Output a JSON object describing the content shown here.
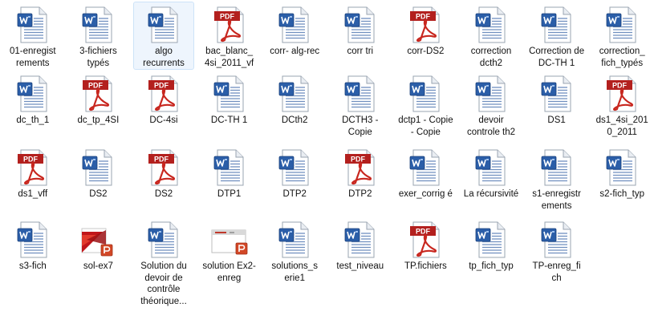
{
  "colors": {
    "selection_bg": "#eef5fd",
    "selection_border": "#cde3f8",
    "pdf_red": "#b3201e",
    "word_blue": "#2b5ea8"
  },
  "files": [
    {
      "name": "01-enregistrements",
      "label": "01-enregist rements",
      "icon": "word-document-icon"
    },
    {
      "name": "3-fichiers typés",
      "label": "3-fichiers typés",
      "icon": "word-document-icon"
    },
    {
      "name": "algo recurrents",
      "label": "algo recurrents",
      "icon": "word-document-icon",
      "selected": true
    },
    {
      "name": "bac_blanc_4si_2011_vf",
      "label": "bac_blanc_ 4si_2011_vf",
      "icon": "pdf-document-icon"
    },
    {
      "name": "corr-alg-rec",
      "label": "corr- alg-rec",
      "icon": "word-document-icon"
    },
    {
      "name": "corr tri",
      "label": "corr tri",
      "icon": "word-document-icon"
    },
    {
      "name": "corr-DS2",
      "label": "corr-DS2",
      "icon": "pdf-document-icon"
    },
    {
      "name": "correction dcth2",
      "label": "correction dcth2",
      "icon": "word-document-icon"
    },
    {
      "name": "Correction de DC-TH 1",
      "label": "Correction de DC-TH 1",
      "icon": "word-document-icon"
    },
    {
      "name": "correction_fich_typés",
      "label": "correction_ fich_typés",
      "icon": "word-document-icon"
    },
    {
      "name": "dc_th_1",
      "label": "dc_th_1",
      "icon": "word-document-icon"
    },
    {
      "name": "dc_tp_4SI",
      "label": "dc_tp_4SI",
      "icon": "pdf-document-icon"
    },
    {
      "name": "DC-4si",
      "label": "DC-4si",
      "icon": "pdf-document-icon"
    },
    {
      "name": "DC-TH 1",
      "label": "DC-TH 1",
      "icon": "word-document-icon"
    },
    {
      "name": "DCth2",
      "label": "DCth2",
      "icon": "word-document-icon"
    },
    {
      "name": "DCTH3 - Copie",
      "label": "DCTH3 - Copie",
      "icon": "word-document-icon"
    },
    {
      "name": "dctp1 - Copie - Copie",
      "label": "dctp1 - Copie - Copie",
      "icon": "word-document-icon"
    },
    {
      "name": "devoir controle th2",
      "label": "devoir controle th2",
      "icon": "word-document-icon"
    },
    {
      "name": "DS1",
      "label": "DS1",
      "icon": "word-document-icon"
    },
    {
      "name": "ds1_4si_2010_2011",
      "label": "ds1_4si_201 0_2011",
      "icon": "pdf-document-icon"
    },
    {
      "name": "ds1_vff",
      "label": "ds1_vff",
      "icon": "pdf-document-icon"
    },
    {
      "name": "DS2",
      "label": "DS2",
      "icon": "word-document-icon"
    },
    {
      "name": "DS2",
      "label": "DS2",
      "icon": "pdf-document-icon"
    },
    {
      "name": "DTP1",
      "label": "DTP1",
      "icon": "word-document-icon"
    },
    {
      "name": "DTP2",
      "label": "DTP2",
      "icon": "word-document-icon"
    },
    {
      "name": "DTP2",
      "label": "DTP2",
      "icon": "pdf-document-icon"
    },
    {
      "name": "exer_corrigé",
      "label": "exer_corrig é",
      "icon": "word-document-icon"
    },
    {
      "name": "La récursivité",
      "label": "La récursivité",
      "icon": "word-document-icon"
    },
    {
      "name": "s1-enregistrements",
      "label": "s1-enregistr ements",
      "icon": "word-document-icon"
    },
    {
      "name": "s2-fich_typ",
      "label": "s2-fich_typ",
      "icon": "word-document-icon"
    },
    {
      "name": "s3-fich",
      "label": "s3-fich",
      "icon": "word-document-icon"
    },
    {
      "name": "sol-ex7",
      "label": "sol-ex7",
      "icon": "powerpoint-document-icon"
    },
    {
      "name": "Solution du devoir de contrôle théorique...",
      "label": "Solution du devoir de contrôle théorique...",
      "icon": "word-document-icon"
    },
    {
      "name": "solution Ex2-enreg",
      "label": "solution Ex2-enreg",
      "icon": "powerpoint-slide-icon"
    },
    {
      "name": "solutions_serie1",
      "label": "solutions_s erie1",
      "icon": "word-document-icon"
    },
    {
      "name": "test_niveau",
      "label": "test_niveau",
      "icon": "word-document-icon"
    },
    {
      "name": "TP.fichiers",
      "label": "TP.fichiers",
      "icon": "pdf-document-icon"
    },
    {
      "name": "tp_fich_typ",
      "label": "tp_fich_typ",
      "icon": "word-document-icon"
    },
    {
      "name": "TP-enreg_fich",
      "label": "TP-enreg_fi ch",
      "icon": "word-document-icon"
    }
  ],
  "icon_text": {
    "pdf": "PDF"
  }
}
